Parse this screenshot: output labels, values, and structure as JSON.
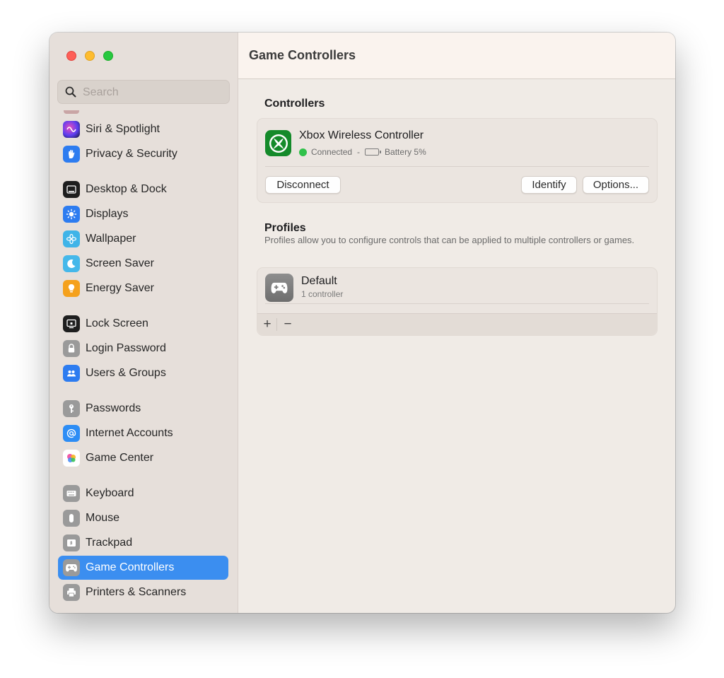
{
  "window": {
    "title": "Game Controllers"
  },
  "search": {
    "placeholder": "Search"
  },
  "sidebar": {
    "items": [
      {
        "label": "Siri & Spotlight",
        "icon": "siri-icon"
      },
      {
        "label": "Privacy & Security",
        "icon": "hand-icon"
      },
      {
        "label": "Desktop & Dock",
        "icon": "dock-icon"
      },
      {
        "label": "Displays",
        "icon": "sun-icon"
      },
      {
        "label": "Wallpaper",
        "icon": "flower-icon"
      },
      {
        "label": "Screen Saver",
        "icon": "moon-icon"
      },
      {
        "label": "Energy Saver",
        "icon": "bulb-icon"
      },
      {
        "label": "Lock Screen",
        "icon": "lock-screen-icon"
      },
      {
        "label": "Login Password",
        "icon": "padlock-icon"
      },
      {
        "label": "Users & Groups",
        "icon": "users-icon"
      },
      {
        "label": "Passwords",
        "icon": "key-icon"
      },
      {
        "label": "Internet Accounts",
        "icon": "at-sign-icon"
      },
      {
        "label": "Game Center",
        "icon": "game-center-icon"
      },
      {
        "label": "Keyboard",
        "icon": "keyboard-icon"
      },
      {
        "label": "Mouse",
        "icon": "mouse-icon"
      },
      {
        "label": "Trackpad",
        "icon": "trackpad-icon"
      },
      {
        "label": "Game Controllers",
        "icon": "gamepad-icon",
        "selected": true
      },
      {
        "label": "Printers & Scanners",
        "icon": "printer-icon"
      }
    ]
  },
  "controllers": {
    "heading": "Controllers",
    "device": {
      "name": "Xbox Wireless Controller",
      "status": "Connected",
      "separator": "-",
      "battery": "Battery 5%",
      "battery_level": 0.05
    },
    "disconnect_label": "Disconnect",
    "identify_label": "Identify",
    "options_label": "Options..."
  },
  "profiles": {
    "heading": "Profiles",
    "description": "Profiles allow you to configure controls that can be applied to multiple controllers or games.",
    "items": [
      {
        "name": "Default",
        "subtitle": "1 controller"
      }
    ],
    "add_label": "+",
    "remove_label": "−"
  },
  "colors": {
    "accent": "#3b8ef0",
    "connected": "#30c14a",
    "xbox_green": "#148a2a"
  }
}
